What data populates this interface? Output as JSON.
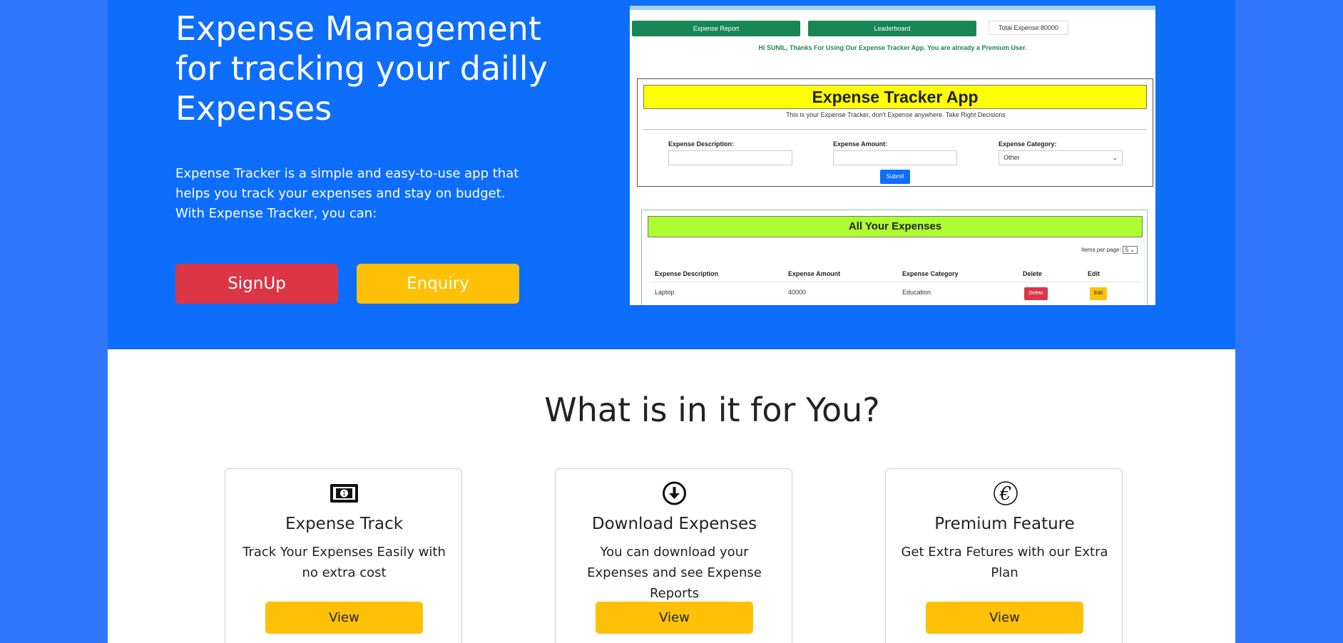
{
  "hero": {
    "title": "Expense Management for tracking your dailly Expenses",
    "description": "Expense Tracker is a simple and easy-to-use app that helps you track your expenses and stay on budget. With Expense Tracker, you can:",
    "signup_label": "SignUp",
    "enquiry_label": "Enquiry"
  },
  "screenshot": {
    "report_btn": "Expense Report",
    "leaderboard_btn": "Leaderboard",
    "total_expense": "Total Expense:80000",
    "greeting": "Hi SUNIL, Thanks For Using Our Expense Tracker App. You are already a Premium User.",
    "app_title": "Expense Tracker App",
    "app_subtitle": "This is your Expense Tracker, don't Expense anywhere. Take Right Decisions",
    "label_description": "Expense Description:",
    "label_amount": "Expense Amount:",
    "label_category": "Expense Category:",
    "category_value": "Other",
    "submit_label": "Submit",
    "list_title": "All Your Expenses",
    "items_per_page_label": "Items per page:",
    "items_per_page_value": "5",
    "columns": [
      "Expense Description",
      "Expense Amount",
      "Expense Category",
      "Delete",
      "Edit"
    ],
    "rows": [
      {
        "description": "Laptop",
        "amount": "40000",
        "category": "Education",
        "delete": "Delete",
        "edit": "Edit"
      }
    ]
  },
  "features": {
    "title": "What is in it for You?",
    "cards": [
      {
        "icon": "money-icon",
        "title": "Expense Track",
        "text": "Track Your Expenses Easily with no extra cost",
        "button": "View"
      },
      {
        "icon": "download-icon",
        "title": "Download Expenses",
        "text": "You can download your Expenses and see Expense Reports",
        "button": "View"
      },
      {
        "icon": "euro-icon",
        "title": "Premium Feature",
        "text": "Get Extra Fetures with our Extra Plan",
        "button": "View"
      }
    ]
  }
}
